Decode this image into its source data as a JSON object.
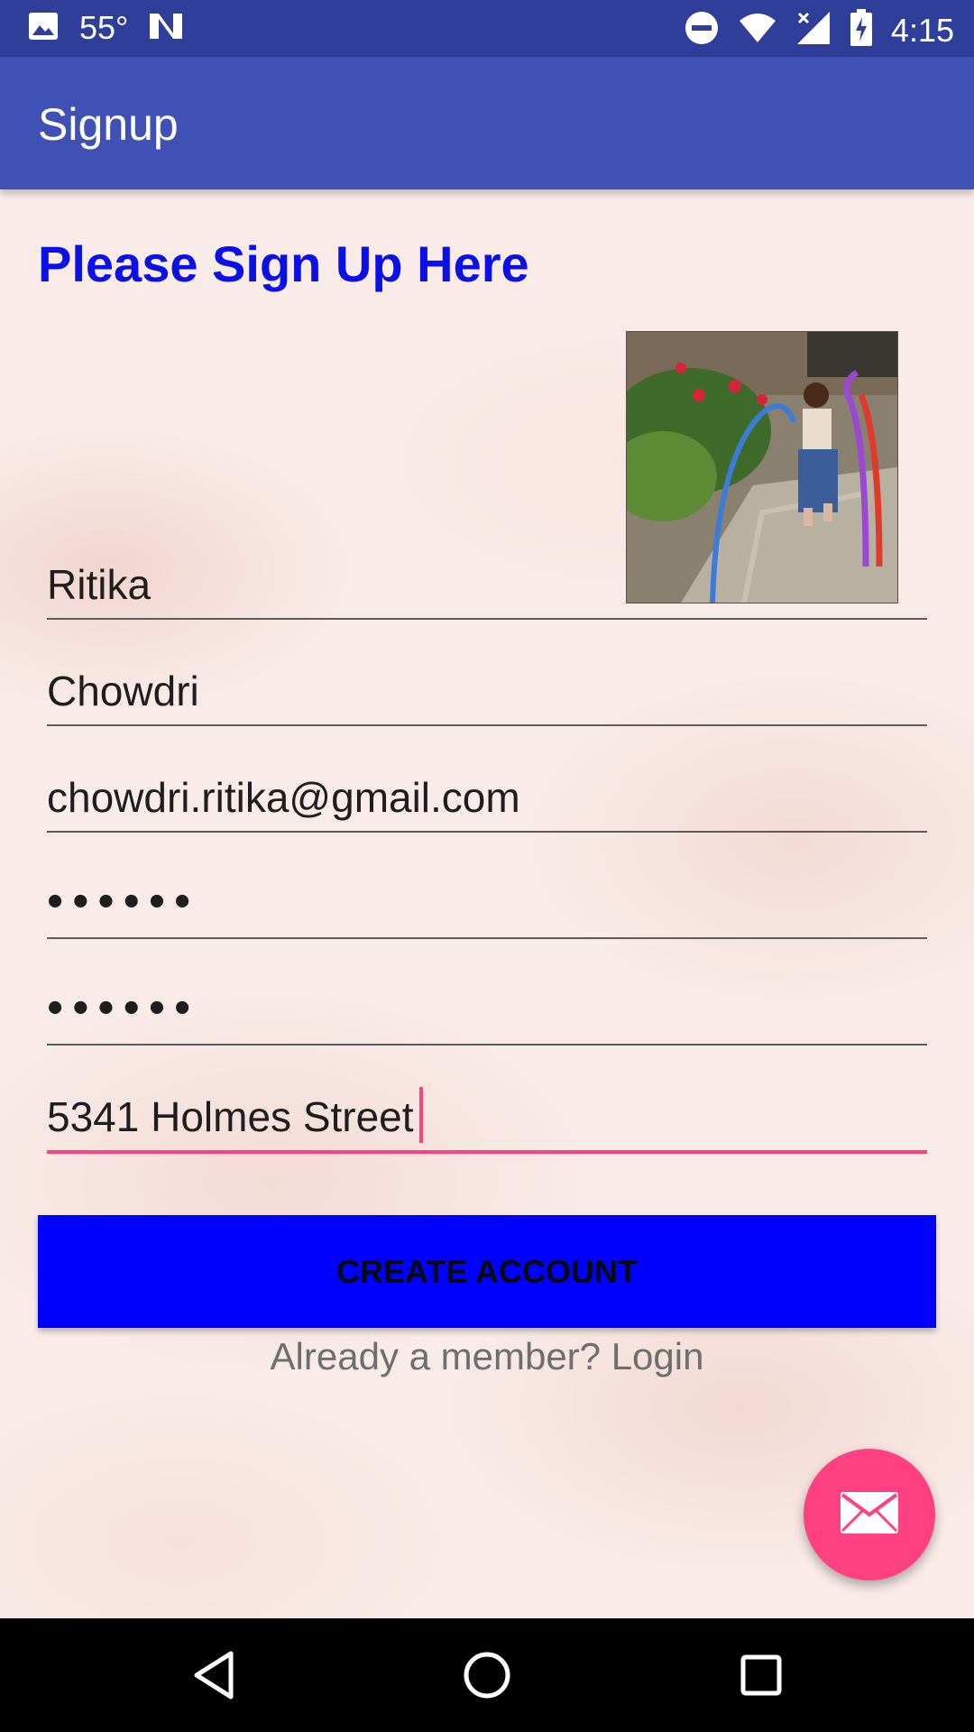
{
  "status_bar": {
    "temperature": "55°",
    "time": "4:15"
  },
  "app_bar": {
    "title": "Signup"
  },
  "form": {
    "heading": "Please Sign Up Here",
    "fields": {
      "first_name": "Ritika",
      "last_name": "Chowdri",
      "email": "chowdri.ritika@gmail.com",
      "password": "••••••",
      "confirm_password": "••••••",
      "address": "5341 Holmes Street"
    },
    "create_button_label": "CREATE ACCOUNT",
    "login_link": "Already a member? Login"
  },
  "colors": {
    "status_bar": "#2f3e98",
    "app_bar": "#3f51b5",
    "heading": "#0a10e6",
    "button": "#0000ff",
    "accent": "#ff4081"
  },
  "icons": {
    "status_left": [
      "image-icon",
      "n-logo-icon"
    ],
    "status_right": [
      "do-not-disturb-icon",
      "wifi-icon",
      "cell-signal-icon",
      "battery-charging-icon"
    ],
    "fab": "mail-icon",
    "nav": [
      "back-icon",
      "home-icon",
      "recents-icon"
    ]
  }
}
